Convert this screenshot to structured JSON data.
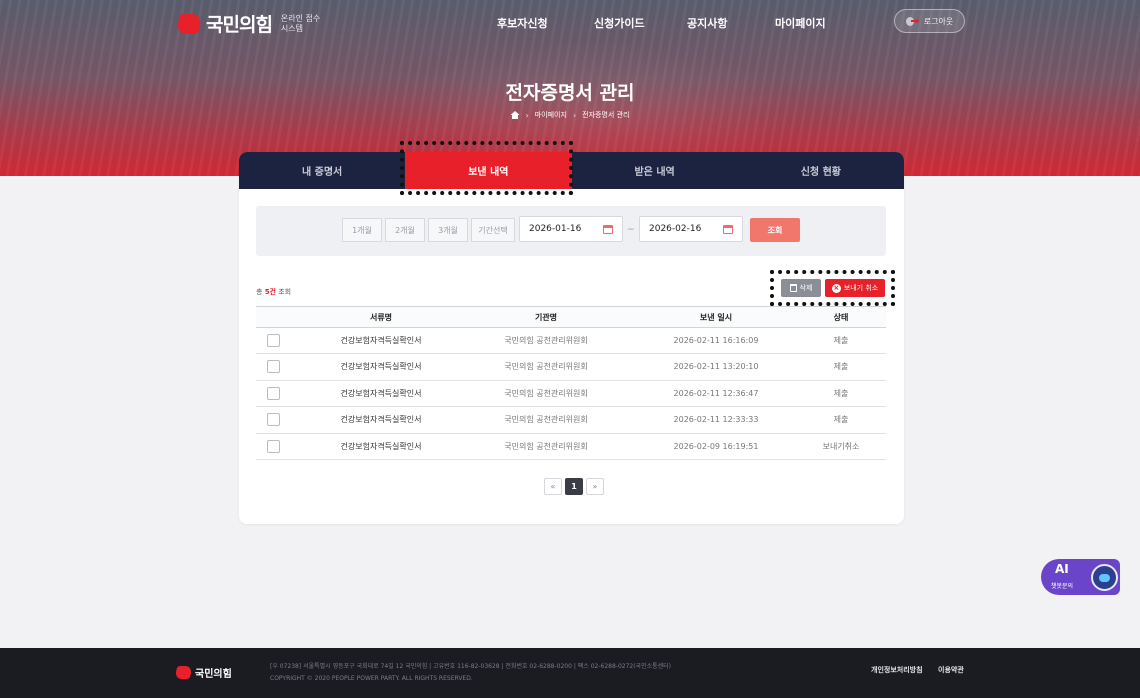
{
  "header": {
    "logo": "국민의힘",
    "logo_sub_line1": "온라인 접수",
    "logo_sub_line2": "시스템",
    "nav": [
      "후보자신청",
      "신청가이드",
      "공지사항",
      "마이페이지"
    ],
    "logout": "로그아웃"
  },
  "page": {
    "title": "전자증명서 관리",
    "breadcrumb": [
      "마이페이지",
      "전자증명서 관리"
    ]
  },
  "tabs": [
    {
      "label": "내 증명서",
      "active": false
    },
    {
      "label": "보낸 내역",
      "active": true
    },
    {
      "label": "받은 내역",
      "active": false
    },
    {
      "label": "신청 현황",
      "active": false
    }
  ],
  "filter": {
    "periods": [
      "1개월",
      "2개월",
      "3개월",
      "기간선택"
    ],
    "start_date": "2026-01-16",
    "tilde": "~",
    "end_date": "2026-02-16",
    "search_label": "조회"
  },
  "summary": {
    "prefix": "총",
    "count": "5건",
    "suffix": "조회"
  },
  "actions": {
    "delete": "삭제",
    "cancel_send": "보내기 취소"
  },
  "table": {
    "headers": [
      "서류명",
      "기관명",
      "보낸 일시",
      "상태"
    ],
    "rows": [
      {
        "doc": "건강보험자격득실확인서",
        "org": "국민의힘 공천관리위원회",
        "sent": "2026-02-11 16:16:09",
        "status": "제출"
      },
      {
        "doc": "건강보험자격득실확인서",
        "org": "국민의힘 공천관리위원회",
        "sent": "2026-02-11 13:20:10",
        "status": "제출"
      },
      {
        "doc": "건강보험자격득실확인서",
        "org": "국민의힘 공천관리위원회",
        "sent": "2026-02-11 12:36:47",
        "status": "제출"
      },
      {
        "doc": "건강보험자격득실확인서",
        "org": "국민의힘 공천관리위원회",
        "sent": "2026-02-11 12:33:33",
        "status": "제출"
      },
      {
        "doc": "건강보험자격득실확인서",
        "org": "국민의힘 공천관리위원회",
        "sent": "2026-02-09 16:19:51",
        "status": "보내기취소"
      }
    ]
  },
  "pagination": {
    "first": "«",
    "current": "1",
    "last": "»"
  },
  "chatbot": {
    "title": "AI",
    "label": "챗봇문의"
  },
  "footer": {
    "logo": "국민의힘",
    "address": "[우 07238] 서울특별시 영등포구 국회대로 74길 12 국민의힘 | 고유번호 116-82-03628 | 전화번호 02-6288-0200 | 팩스 02-6288-0272(국민소통센터)",
    "copyright": "COPYRIGHT © 2020 PEOPLE POWER PARTY. ALL RIGHTS RESERVED.",
    "links": [
      "개인정보처리방침",
      "이용약관"
    ]
  },
  "colors": {
    "brand_red": "#e8202a",
    "tab_bar": "#1c2340",
    "footer_bg": "#1a1c22",
    "chatbot": "#6a45c9"
  }
}
